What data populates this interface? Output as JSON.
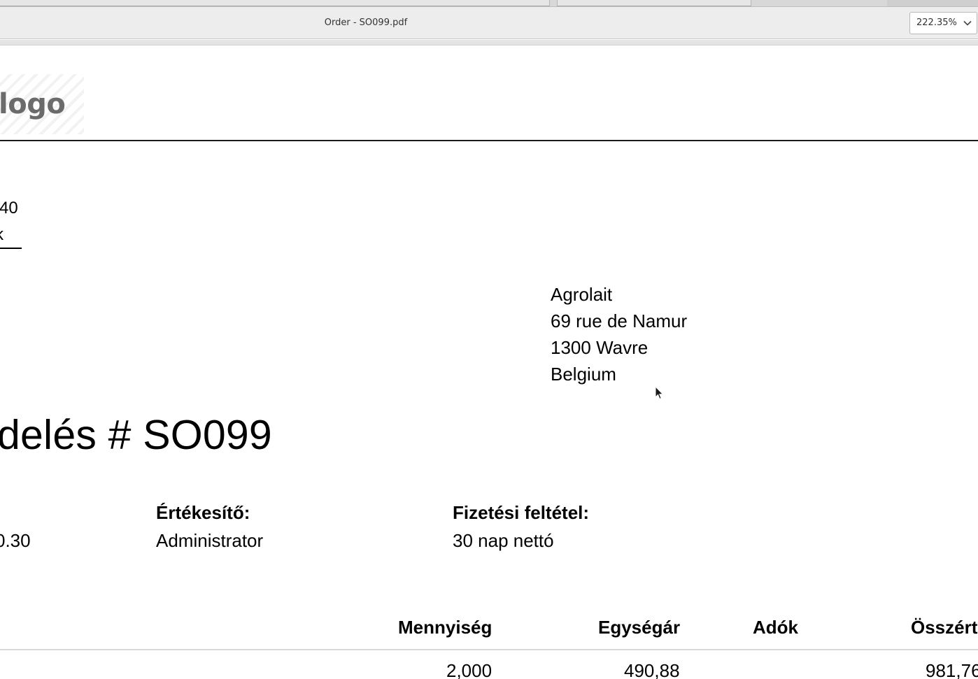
{
  "viewer": {
    "document_title": "Order - SO099.pdf",
    "zoom": "222.35%"
  },
  "page": {
    "logo_text": "logo",
    "company_lines": [
      ".",
      "40",
      "k"
    ],
    "customer_address": [
      "Agrolait",
      "69 rue de Namur",
      "1300 Wavre",
      "Belgium"
    ],
    "order_title": "delés # SO099",
    "info": {
      "date_value": "0.30",
      "salesperson_label": "Értékesítő:",
      "salesperson_value": "Administrator",
      "payment_term_label": "Fizetési feltétel:",
      "payment_term_value": "30 nap nettó"
    },
    "table": {
      "headers": {
        "quantity": "Mennyiség",
        "unit_price": "Egységár",
        "taxes": "Adók",
        "total": "Összért"
      },
      "rows": [
        {
          "quantity": "2,000",
          "unit_price": "490,88",
          "taxes": "",
          "total": "981,76"
        }
      ]
    }
  }
}
